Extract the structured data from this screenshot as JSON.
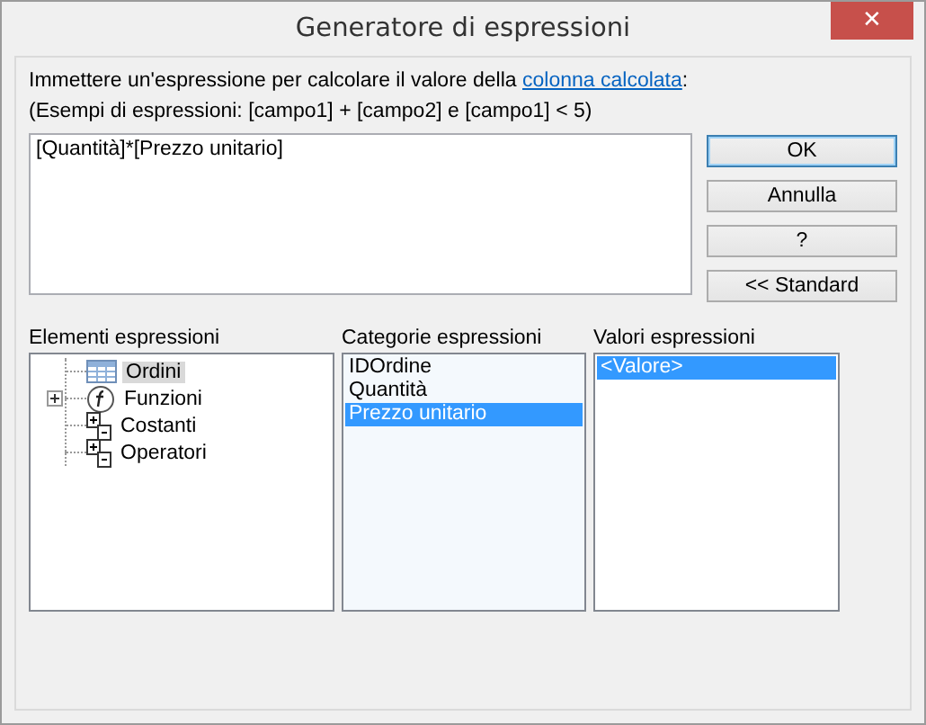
{
  "window": {
    "title": "Generatore di espressioni",
    "close": "✕"
  },
  "instruction": {
    "before": "Immettere un'espressione per calcolare il valore della",
    "link": "colonna calcolata",
    "after": ":"
  },
  "example": "(Esempi di espressioni: [campo1] + [campo2] e [campo1] < 5)",
  "expression": {
    "value": "[Quantità]*[Prezzo unitario]"
  },
  "buttons": [
    {
      "label": "OK",
      "default": true
    },
    {
      "label": "Annulla",
      "default": false
    },
    {
      "label": "?",
      "default": false
    },
    {
      "label": "<< Standard",
      "default": false
    }
  ],
  "elements": {
    "label": "Elementi espressioni",
    "items": [
      {
        "label": "Ordini",
        "kind": "table",
        "collapsed": false,
        "selected": true
      },
      {
        "label": "Funzioni",
        "kind": "functions",
        "collapsed": true,
        "selected": false
      },
      {
        "label": "Costanti",
        "kind": "constants",
        "collapsed": false,
        "selected": false
      },
      {
        "label": "Operatori",
        "kind": "operators",
        "collapsed": false,
        "selected": false
      }
    ]
  },
  "categories": {
    "label": "Categorie espressioni",
    "items": [
      {
        "label": "IDOrdine",
        "selected": false
      },
      {
        "label": "Quantità",
        "selected": false
      },
      {
        "label": "Prezzo unitario",
        "selected": true
      }
    ]
  },
  "values": {
    "label": "Valori espressioni",
    "items": [
      {
        "label": "<Valore>",
        "selected": true
      }
    ]
  }
}
